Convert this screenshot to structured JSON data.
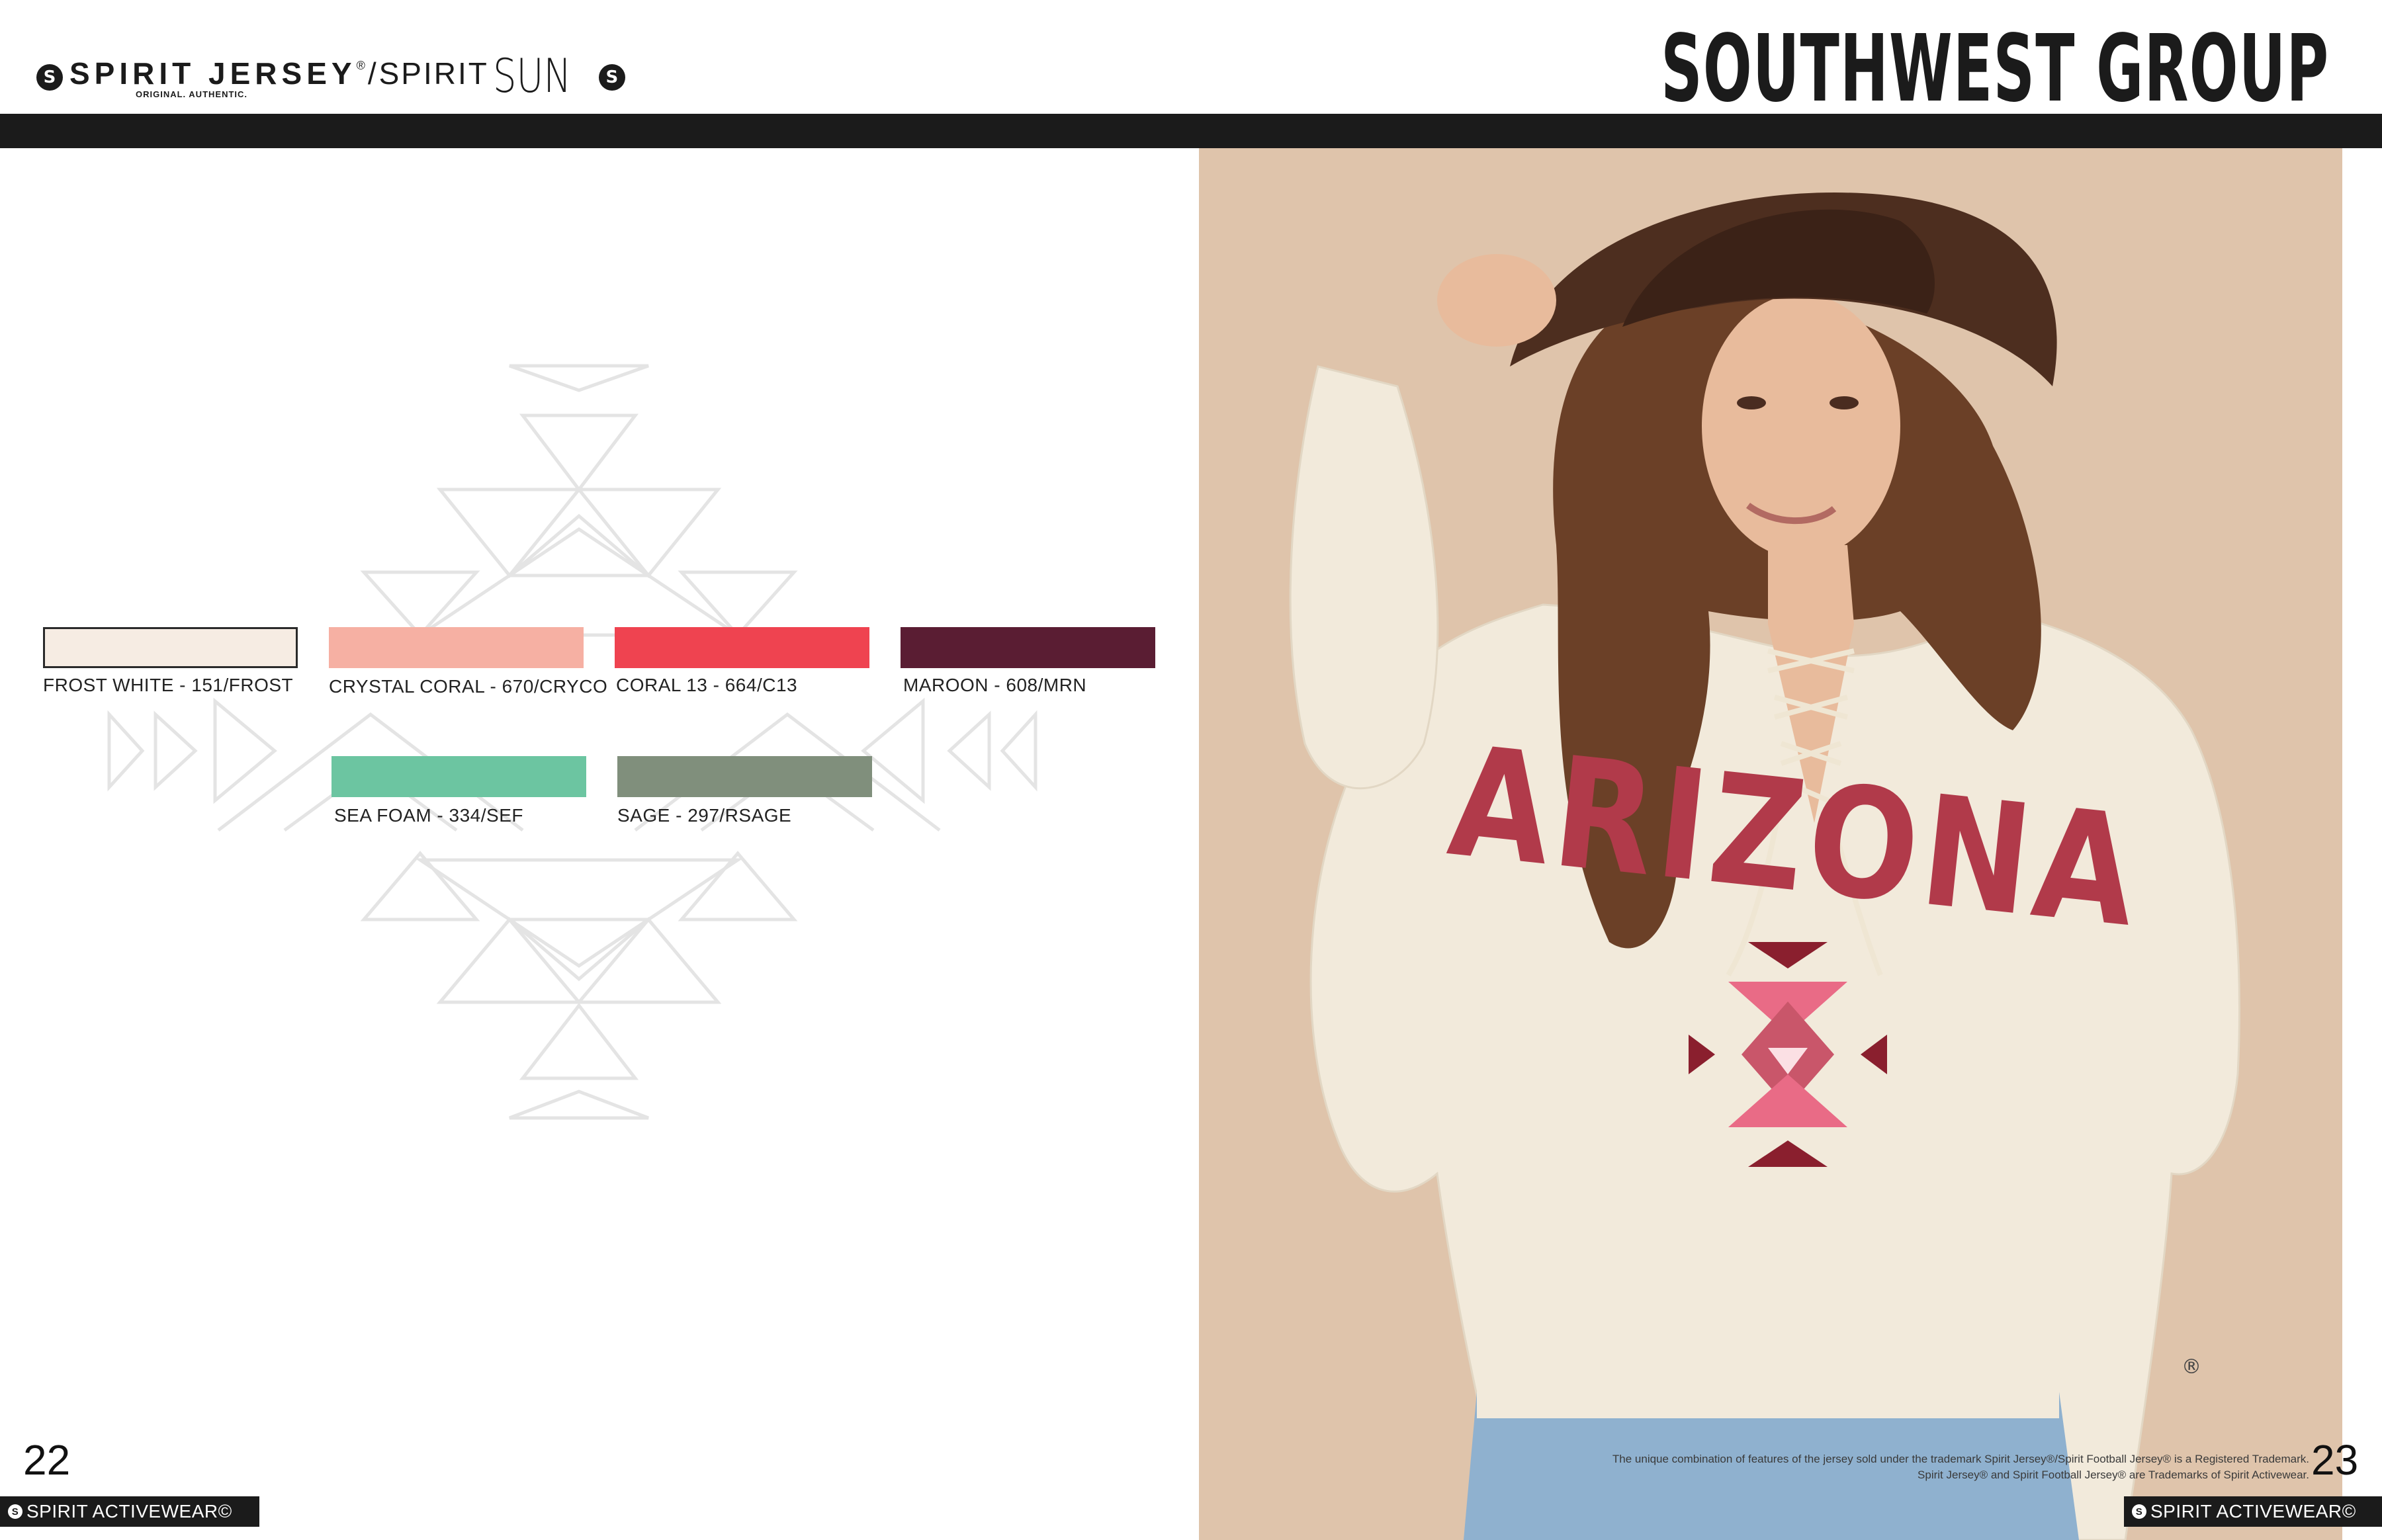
{
  "header": {
    "brand_logo_glyph": "S",
    "brand_name": "SPIRIT JERSEY",
    "brand_reg": "®",
    "brand_tagline": "ORIGINAL. AUTHENTIC.",
    "separator": "/",
    "brand_spirit": "SPIRIT",
    "brand_sun": "SUN",
    "collection_title": "SOUTHWEST GROUP"
  },
  "colors": {
    "header_bar": "#1b1b1b",
    "photo_background": "#dfc4ab",
    "aztec_outline": "#e4e4e4"
  },
  "swatches": [
    {
      "label": "FROST WHITE - 151/FROST",
      "color": "#f6ece3",
      "outlined": true
    },
    {
      "label": "CRYSTAL CORAL - 670/CRYCO",
      "color": "#f6b0a3",
      "outlined": false
    },
    {
      "label": "CORAL 13 - 664/C13",
      "color": "#ef4350",
      "outlined": false
    },
    {
      "label": "MAROON - 608/MRN",
      "color": "#5a1d33",
      "outlined": false
    },
    {
      "label": "SEA FOAM - 334/SEF",
      "color": "#6cc5a1",
      "outlined": false
    },
    {
      "label": "SAGE - 297/RSAGE",
      "color": "#808f7c",
      "outlined": false
    }
  ],
  "pages": {
    "left_number": "22",
    "right_number": "23",
    "footer_brand": "SPIRIT ACTIVEWEAR©",
    "footer_logo_glyph": "S"
  },
  "product": {
    "shirt_print": "ARIZONA",
    "registered_mark": "®"
  },
  "legal": {
    "line1": "The unique combination of features of the jersey sold under the trademark Spirit Jersey®/Spirit Football Jersey® is a Registered Trademark.",
    "line2": "Spirit Jersey® and Spirit Football Jersey® are Trademarks of Spirit Activewear."
  }
}
